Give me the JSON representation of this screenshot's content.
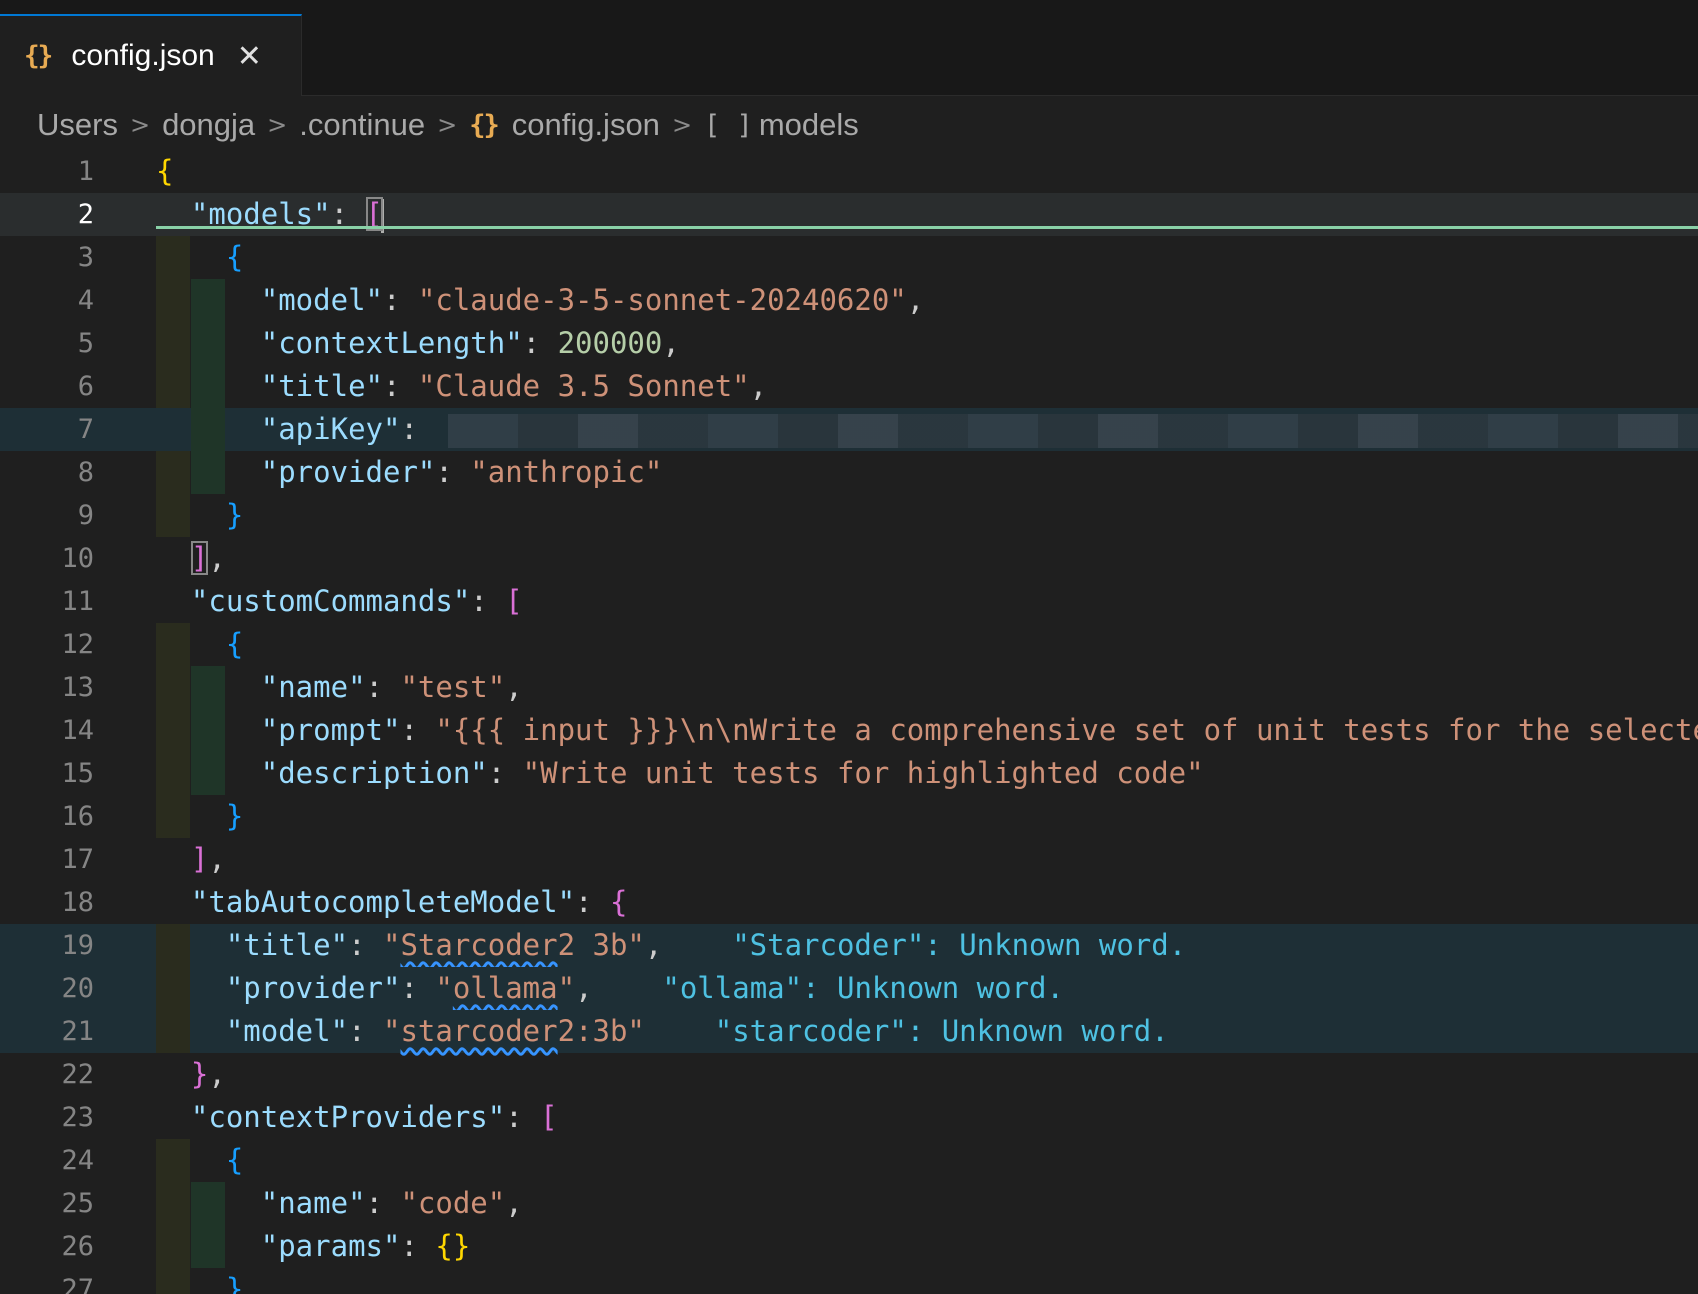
{
  "tab": {
    "icon": "{}",
    "title": "config.json",
    "close": "✕"
  },
  "breadcrumb": {
    "items": [
      "Users",
      "dongja",
      ".continue",
      "config.json",
      "models"
    ],
    "separator": ">",
    "array_icon": "[ ]"
  },
  "lines": [
    {
      "no": "1"
    },
    {
      "no": "2"
    },
    {
      "no": "3"
    },
    {
      "no": "4"
    },
    {
      "no": "5"
    },
    {
      "no": "6"
    },
    {
      "no": "7"
    },
    {
      "no": "8"
    },
    {
      "no": "9"
    },
    {
      "no": "10"
    },
    {
      "no": "11"
    },
    {
      "no": "12"
    },
    {
      "no": "13"
    },
    {
      "no": "14"
    },
    {
      "no": "15"
    },
    {
      "no": "16"
    },
    {
      "no": "17"
    },
    {
      "no": "18"
    },
    {
      "no": "19"
    },
    {
      "no": "20"
    },
    {
      "no": "21"
    },
    {
      "no": "22"
    },
    {
      "no": "23"
    },
    {
      "no": "24"
    },
    {
      "no": "25"
    },
    {
      "no": "26"
    },
    {
      "no": "27"
    }
  ],
  "code": {
    "k_models": "\"models\"",
    "k_model": "\"model\"",
    "v_model": "\"claude-3-5-sonnet-20240620\"",
    "k_contextLength": "\"contextLength\"",
    "v_contextLength": "200000",
    "k_title": "\"title\"",
    "v_title": "\"Claude 3.5 Sonnet\"",
    "k_apiKey": "\"apiKey\"",
    "k_provider": "\"provider\"",
    "v_provider": "\"anthropic\"",
    "k_customCommands": "\"customCommands\"",
    "k_name": "\"name\"",
    "v_name_test": "\"test\"",
    "k_prompt": "\"prompt\"",
    "v_prompt": "\"{{{ input }}}\\n\\nWrite a comprehensive set of unit tests for the selecte",
    "k_description": "\"description\"",
    "v_description": "\"Write unit tests for highlighted code\"",
    "k_tabAutocompleteModel": "\"tabAutocompleteModel\"",
    "v_ac_title_q": "\"",
    "v_ac_title_word": "Starcoder",
    "v_ac_title_rest": "2 3b\"",
    "hint_19": "\"Starcoder\": Unknown word.",
    "v_ac_provider_word": "ollama",
    "hint_20": "\"ollama\": Unknown word.",
    "v_ac_model_word": "starcoder",
    "v_ac_model_rest": "2:3b\"",
    "hint_21": "\"starcoder\": Unknown word.",
    "k_contextProviders": "\"contextProviders\"",
    "v_name_code": "\"code\"",
    "k_params": "\"params\""
  }
}
